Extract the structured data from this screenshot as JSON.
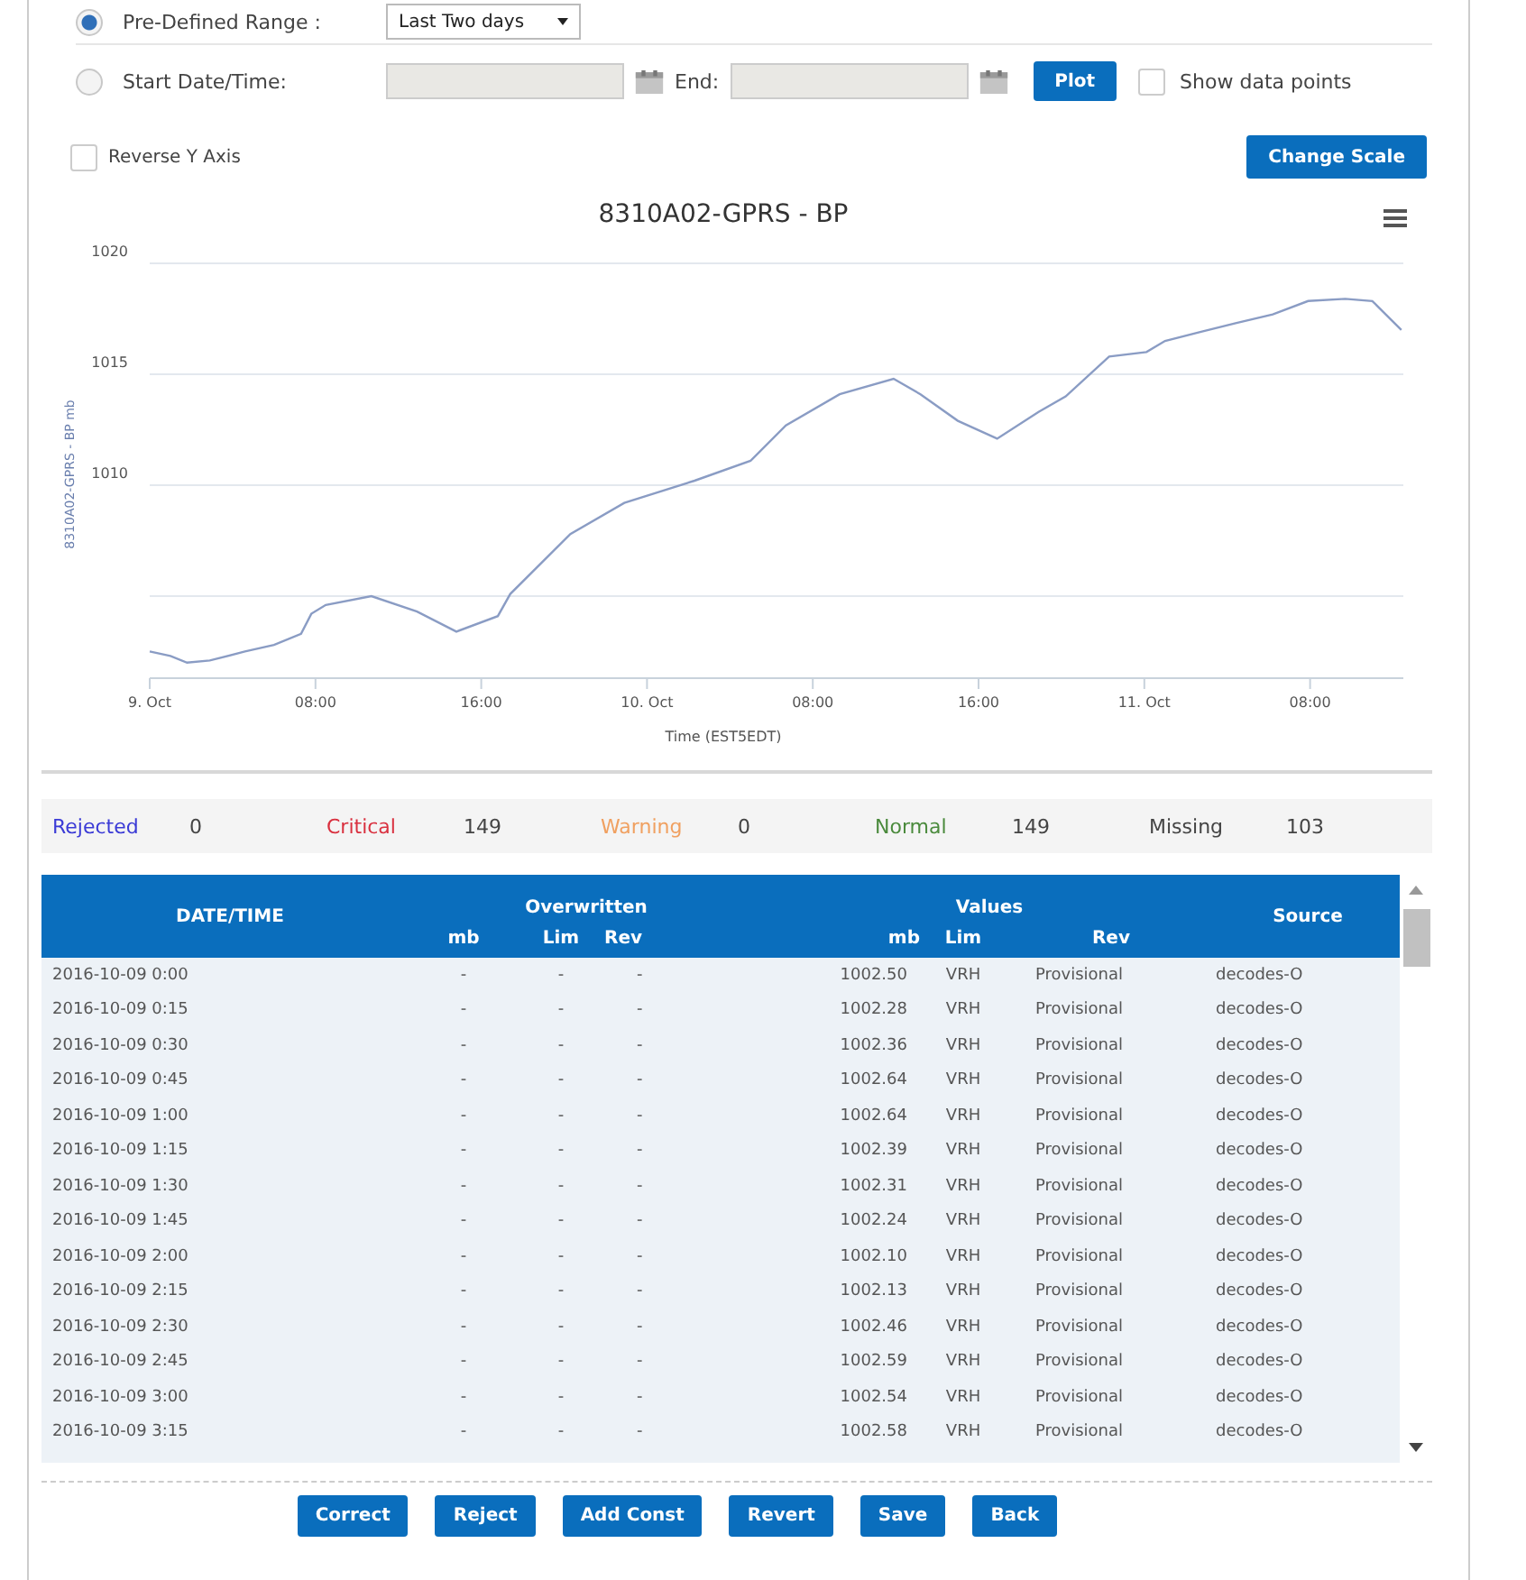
{
  "range_options": [
    {
      "label": "Pre-Defined Range :",
      "selected": true,
      "kind": "preset",
      "value": "Last Two days"
    },
    {
      "label": "Start Date/Time:",
      "selected": false,
      "kind": "custom",
      "end_label": "End:"
    }
  ],
  "plot_button": "Plot",
  "show_points": {
    "label": "Show data points",
    "checked": false
  },
  "reverse_axis": {
    "label": "Reverse Y Axis",
    "checked": false
  },
  "change_scale_button": "Change Scale",
  "chart": {
    "chart_data": {
      "type": "line",
      "title": "8310A02-GPRS - BP",
      "xlabel": "Time (EST5EDT)",
      "ylabel": "8310A02-GPRS - BP mb",
      "ylim": [
        1001.3,
        1020
      ],
      "xlim": [
        "2016-10-09 00:00",
        "2016-10-11 12:30"
      ],
      "grid": true,
      "yticks": [
        1010,
        1015,
        1020
      ],
      "xticks": [
        {
          "value": "2016-10-09 00:00",
          "label": "9. Oct"
        },
        {
          "value": "2016-10-09 08:00",
          "label": "08:00"
        },
        {
          "value": "2016-10-09 16:00",
          "label": "16:00"
        },
        {
          "value": "2016-10-10 00:00",
          "label": "10. Oct"
        },
        {
          "value": "2016-10-10 08:00",
          "label": "08:00"
        },
        {
          "value": "2016-10-10 16:00",
          "label": "16:00"
        },
        {
          "value": "2016-10-11 00:00",
          "label": "11. Oct"
        },
        {
          "value": "2016-10-11 08:00",
          "label": "08:00"
        }
      ],
      "x": [
        "2016-10-09 00:00",
        "2016-10-09 01:00",
        "2016-10-09 01:48",
        "2016-10-09 02:54",
        "2016-10-09 04:36",
        "2016-10-09 06:00",
        "2016-10-09 07:18",
        "2016-10-09 07:48",
        "2016-10-09 08:30",
        "2016-10-09 10:42",
        "2016-10-09 12:54",
        "2016-10-09 14:48",
        "2016-10-09 16:48",
        "2016-10-09 17:24",
        "2016-10-09 20:18",
        "2016-10-09 22:54",
        "2016-10-10 02:18",
        "2016-10-10 05:00",
        "2016-10-10 06:42",
        "2016-10-10 09:18",
        "2016-10-10 11:54",
        "2016-10-10 13:12",
        "2016-10-10 15:00",
        "2016-10-10 16:54",
        "2016-10-10 18:54",
        "2016-10-10 20:12",
        "2016-10-10 22:18",
        "2016-10-11 00:06",
        "2016-10-11 01:00",
        "2016-10-11 02:42",
        "2016-10-11 04:24",
        "2016-10-11 06:12",
        "2016-10-11 07:54",
        "2016-10-11 09:42",
        "2016-10-11 11:00",
        "2016-10-11 12:24"
      ],
      "series": [
        {
          "color": "#8a9cc4",
          "values": [
            1002.5,
            1002.3,
            1002.0,
            1002.1,
            1002.5,
            1002.8,
            1003.3,
            1004.2,
            1004.6,
            1005.0,
            1004.3,
            1003.4,
            1004.1,
            1005.1,
            1007.8,
            1009.2,
            1010.2,
            1011.1,
            1012.7,
            1014.1,
            1014.8,
            1014.1,
            1012.9,
            1012.1,
            1013.3,
            1014.0,
            1015.8,
            1016.0,
            1016.5,
            1016.9,
            1017.3,
            1017.7,
            1018.3,
            1018.4,
            1018.3,
            1017.0
          ]
        }
      ]
    }
  },
  "status_counts": [
    {
      "label": "Rejected",
      "count": "0",
      "color": "#3b3bd6"
    },
    {
      "label": "Critical",
      "count": "149",
      "color": "#d9303f"
    },
    {
      "label": "Warning",
      "count": "0",
      "color": "#f0a060"
    },
    {
      "label": "Normal",
      "count": "149",
      "color": "#4a8a3c"
    },
    {
      "label": "Missing",
      "count": "103",
      "color": "#444444"
    }
  ],
  "table": {
    "date_header": "DATE/TIME",
    "groups": [
      "Overwritten",
      "Values"
    ],
    "source_header": "Source",
    "sub_headers": [
      "mb",
      "Lim",
      "Rev",
      "mb",
      "Lim",
      "Rev"
    ],
    "rows": [
      [
        "2016-10-09 0:00",
        "-",
        "-",
        "-",
        "1002.50",
        "VRH",
        "Provisional",
        "decodes-O"
      ],
      [
        "2016-10-09 0:15",
        "-",
        "-",
        "-",
        "1002.28",
        "VRH",
        "Provisional",
        "decodes-O"
      ],
      [
        "2016-10-09 0:30",
        "-",
        "-",
        "-",
        "1002.36",
        "VRH",
        "Provisional",
        "decodes-O"
      ],
      [
        "2016-10-09 0:45",
        "-",
        "-",
        "-",
        "1002.64",
        "VRH",
        "Provisional",
        "decodes-O"
      ],
      [
        "2016-10-09 1:00",
        "-",
        "-",
        "-",
        "1002.64",
        "VRH",
        "Provisional",
        "decodes-O"
      ],
      [
        "2016-10-09 1:15",
        "-",
        "-",
        "-",
        "1002.39",
        "VRH",
        "Provisional",
        "decodes-O"
      ],
      [
        "2016-10-09 1:30",
        "-",
        "-",
        "-",
        "1002.31",
        "VRH",
        "Provisional",
        "decodes-O"
      ],
      [
        "2016-10-09 1:45",
        "-",
        "-",
        "-",
        "1002.24",
        "VRH",
        "Provisional",
        "decodes-O"
      ],
      [
        "2016-10-09 2:00",
        "-",
        "-",
        "-",
        "1002.10",
        "VRH",
        "Provisional",
        "decodes-O"
      ],
      [
        "2016-10-09 2:15",
        "-",
        "-",
        "-",
        "1002.13",
        "VRH",
        "Provisional",
        "decodes-O"
      ],
      [
        "2016-10-09 2:30",
        "-",
        "-",
        "-",
        "1002.46",
        "VRH",
        "Provisional",
        "decodes-O"
      ],
      [
        "2016-10-09 2:45",
        "-",
        "-",
        "-",
        "1002.59",
        "VRH",
        "Provisional",
        "decodes-O"
      ],
      [
        "2016-10-09 3:00",
        "-",
        "-",
        "-",
        "1002.54",
        "VRH",
        "Provisional",
        "decodes-O"
      ],
      [
        "2016-10-09 3:15",
        "-",
        "-",
        "-",
        "1002.58",
        "VRH",
        "Provisional",
        "decodes-O"
      ]
    ]
  },
  "actions": [
    "Correct",
    "Reject",
    "Add Const",
    "Revert",
    "Save",
    "Back"
  ]
}
